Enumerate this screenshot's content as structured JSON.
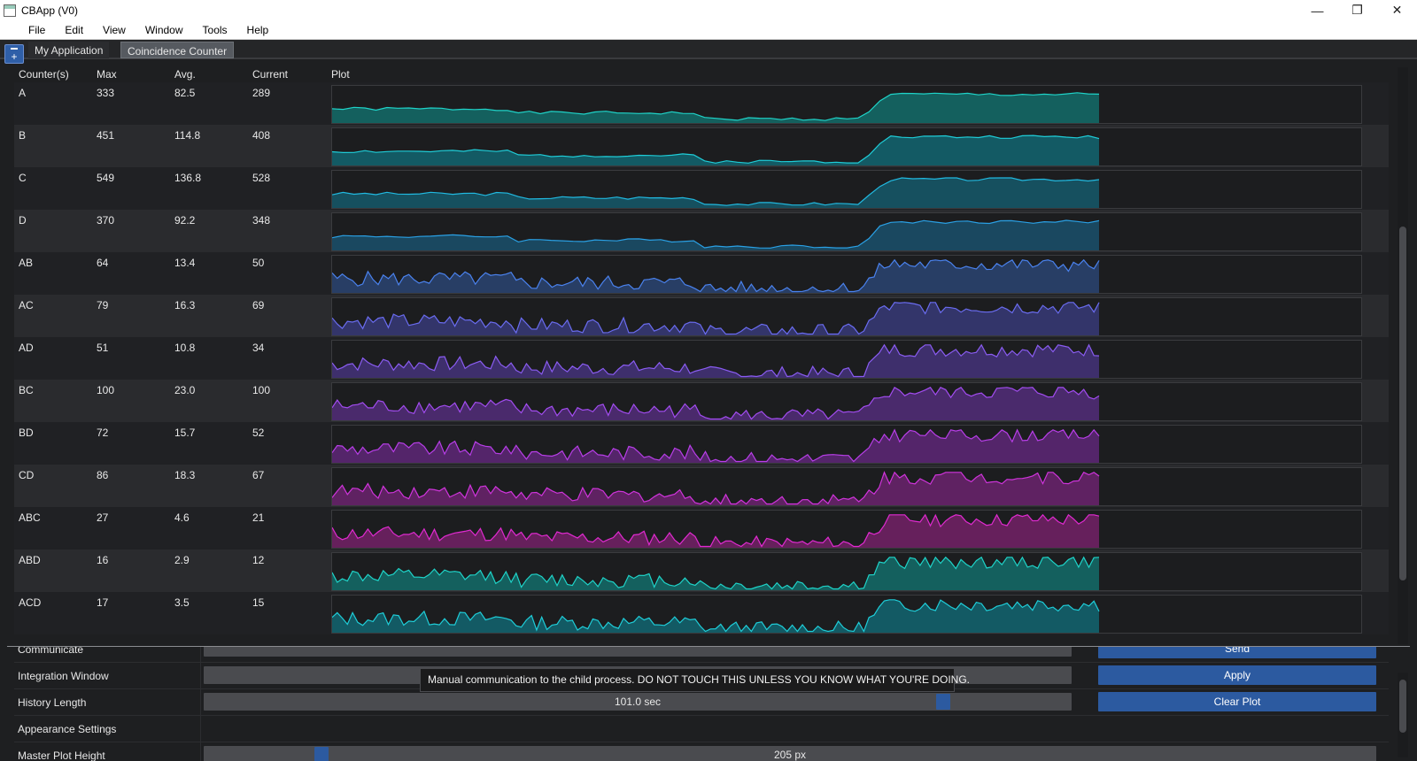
{
  "window": {
    "title": "CBApp (V0)",
    "controls": [
      "—",
      "❐",
      "✕"
    ]
  },
  "menu": [
    "File",
    "Edit",
    "View",
    "Window",
    "Tools",
    "Help"
  ],
  "dock_button": "+",
  "tabs": [
    {
      "label": "My Application",
      "active": false
    },
    {
      "label": "Coincidence Counter",
      "active": true
    }
  ],
  "table": {
    "headers": [
      "Counter(s)",
      "Max",
      "Avg.",
      "Current",
      "Plot"
    ],
    "rows": [
      {
        "name": "A",
        "max": "333",
        "avg": "82.5",
        "current": "289",
        "color": "#1fd3c8",
        "fill": "#14605e",
        "spiky": false,
        "seed": 1
      },
      {
        "name": "B",
        "max": "451",
        "avg": "114.8",
        "current": "408",
        "color": "#1fcdd8",
        "fill": "#135a64",
        "spiky": false,
        "seed": 2
      },
      {
        "name": "C",
        "max": "549",
        "avg": "136.8",
        "current": "528",
        "color": "#21b9e0",
        "fill": "#16505f",
        "spiky": false,
        "seed": 3
      },
      {
        "name": "D",
        "max": "370",
        "avg": "92.2",
        "current": "348",
        "color": "#2aa0e4",
        "fill": "#1a4860",
        "spiky": false,
        "seed": 4
      },
      {
        "name": "AB",
        "max": "64",
        "avg": "13.4",
        "current": "50",
        "color": "#4a82ee",
        "fill": "#283e65",
        "spiky": true,
        "seed": 5
      },
      {
        "name": "AC",
        "max": "79",
        "avg": "16.3",
        "current": "69",
        "color": "#6a6cf0",
        "fill": "#33356a",
        "spiky": true,
        "seed": 6
      },
      {
        "name": "AD",
        "max": "51",
        "avg": "10.8",
        "current": "34",
        "color": "#8a5cf2",
        "fill": "#3e2f6c",
        "spiky": true,
        "seed": 7
      },
      {
        "name": "BC",
        "max": "100",
        "avg": "23.0",
        "current": "100",
        "color": "#a24cf0",
        "fill": "#4a2a6c",
        "spiky": true,
        "seed": 8
      },
      {
        "name": "BD",
        "max": "72",
        "avg": "15.7",
        "current": "52",
        "color": "#b83ee8",
        "fill": "#54256a",
        "spiky": true,
        "seed": 9
      },
      {
        "name": "CD",
        "max": "86",
        "avg": "18.3",
        "current": "67",
        "color": "#d034dc",
        "fill": "#5f2262",
        "spiky": true,
        "seed": 10
      },
      {
        "name": "ABC",
        "max": "27",
        "avg": "4.6",
        "current": "21",
        "color": "#e02ad0",
        "fill": "#66205c",
        "spiky": true,
        "seed": 11
      },
      {
        "name": "ABD",
        "max": "16",
        "avg": "2.9",
        "current": "12",
        "color": "#1fd3c8",
        "fill": "#14605e",
        "spiky": true,
        "seed": 12
      },
      {
        "name": "ACD",
        "max": "17",
        "avg": "3.5",
        "current": "15",
        "color": "#1fcdd8",
        "fill": "#135a64",
        "spiky": true,
        "seed": 13
      }
    ]
  },
  "settings": {
    "communicate": {
      "label": "Communicate",
      "button": "Send"
    },
    "integration": {
      "label": "Integration Window",
      "button": "Apply"
    },
    "history": {
      "label": "History Length",
      "value": "101.0 sec",
      "button": "Clear Plot"
    },
    "appearance": {
      "label": "Appearance Settings"
    },
    "master_height": {
      "label": "Master Plot Height",
      "value": "205 px"
    }
  },
  "tooltip": "Manual communication to the child process.  DO NOT TOUCH THIS UNLESS YOU KNOW WHAT YOU'RE DOING."
}
